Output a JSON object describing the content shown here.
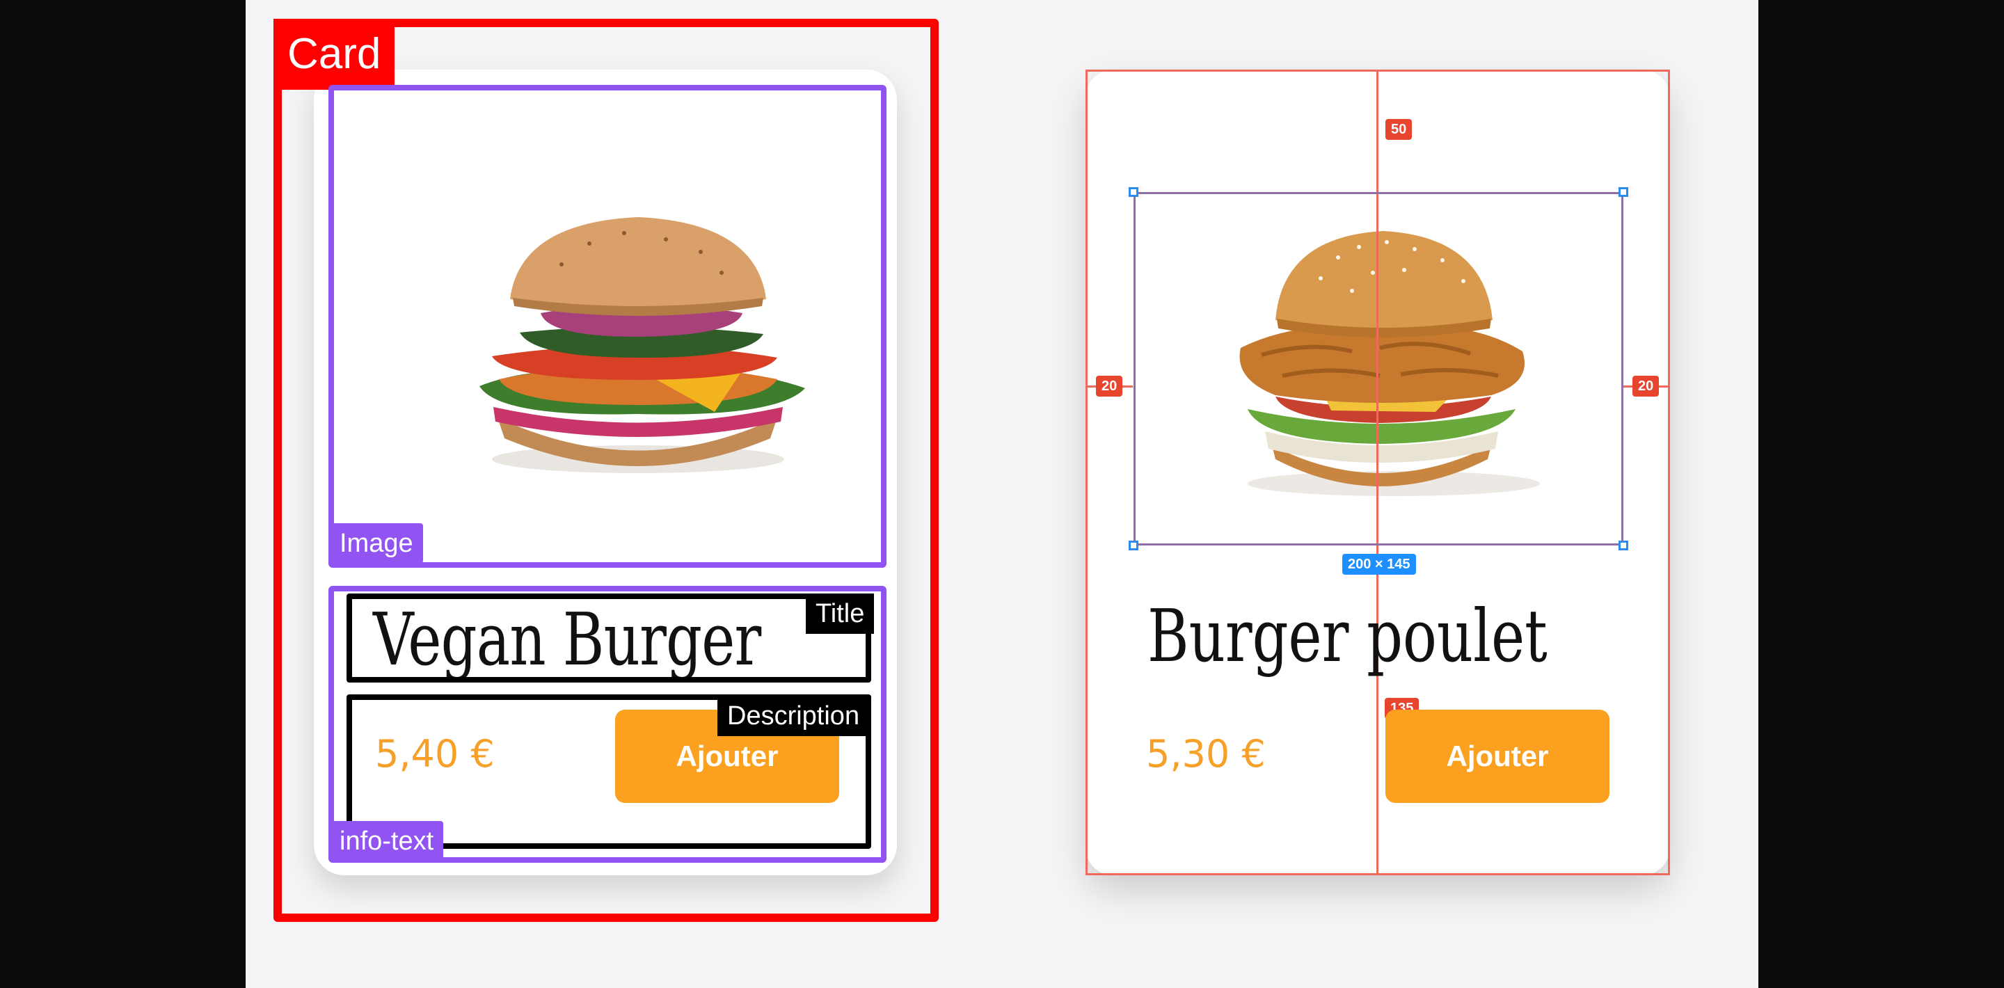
{
  "annotations": {
    "card_tag": "Card",
    "image_tag": "Image",
    "info_text_tag": "info-text",
    "title_tag": "Title",
    "description_tag": "Description"
  },
  "card_left": {
    "title": "Vegan Burger",
    "price": "5,40 €",
    "button_label": "Ajouter",
    "image_icon": "veggie-burger-photo"
  },
  "card_right": {
    "title": "Burger poulet",
    "price": "5,30 €",
    "button_label": "Ajouter",
    "image_icon": "chicken-burger-photo"
  },
  "measurements": {
    "top_spacing": "50",
    "left_spacing": "20",
    "right_spacing": "20",
    "image_size": "200 × 145",
    "vertical_offset": "135"
  },
  "colors": {
    "accent": "#fca11f",
    "price": "#f7a028",
    "annotation_card": "#ff0000",
    "annotation_section": "#9154f3",
    "measure_guide": "#ef6a5a",
    "measure_badge": "#e8452f",
    "selection_badge": "#1e8fff"
  }
}
